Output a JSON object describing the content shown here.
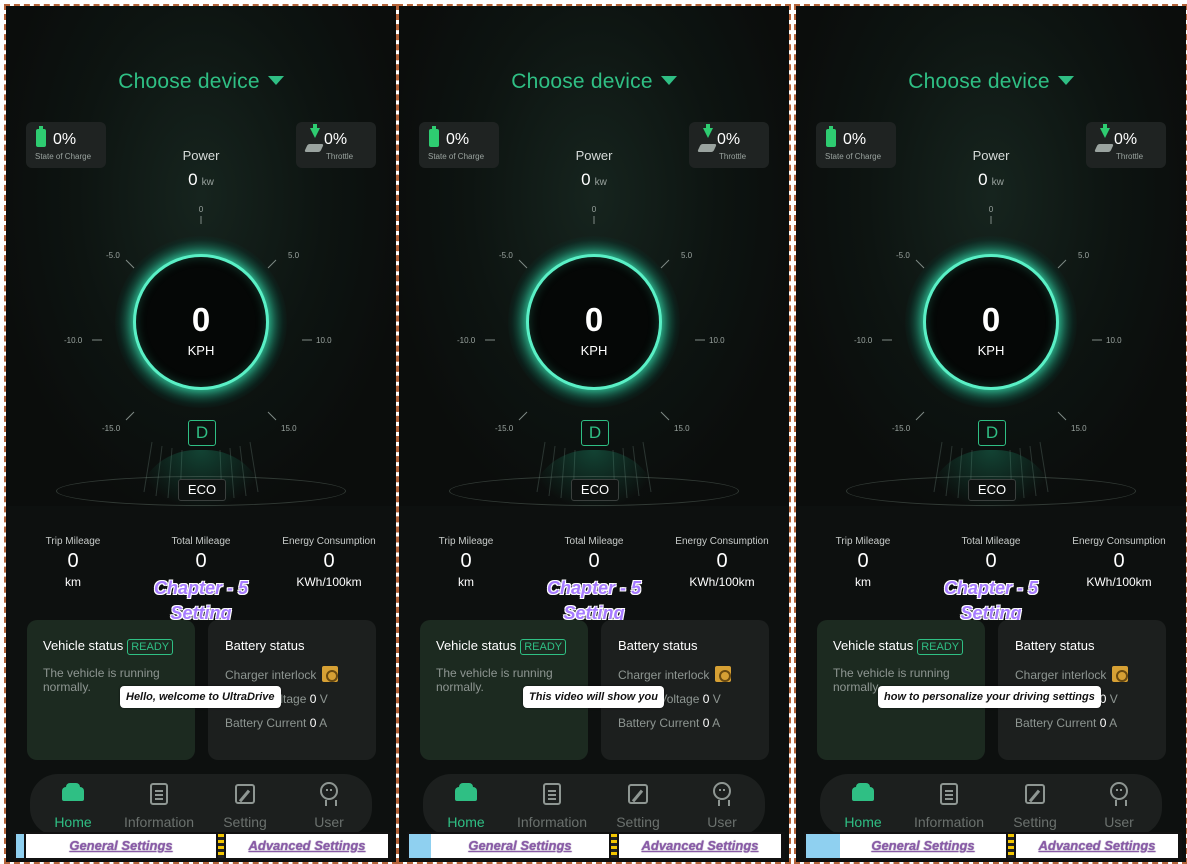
{
  "title": "Choose device",
  "state_of_charge": {
    "value": "0%",
    "label": "State of Charge"
  },
  "throttle": {
    "value": "0%",
    "label": "Throttle"
  },
  "power": {
    "label": "Power",
    "value": "0",
    "unit": "kw"
  },
  "gauge": {
    "ticks": [
      "0",
      "5.0",
      "10.0",
      "15.0",
      "-5.0",
      "-10.0",
      "-15.0"
    ],
    "speed": "0",
    "speed_unit": "KPH",
    "gear": "D",
    "mode": "ECO"
  },
  "stats": {
    "trip": {
      "label": "Trip Mileage",
      "value": "0",
      "unit": "km"
    },
    "total": {
      "label": "Total Mileage",
      "value": "0",
      "unit": ""
    },
    "energy": {
      "label": "Energy Consumption",
      "value": "0",
      "unit": "KWh/100km"
    }
  },
  "chapter": {
    "line1": "Chapter - 5",
    "line2": "Setting"
  },
  "vehicle": {
    "title": "Vehicle status",
    "badge": "READY",
    "desc": "The vehicle is running normally."
  },
  "battery": {
    "title": "Battery status",
    "charger_label": "Charger interlock",
    "voltage_label": "Battery Voltage",
    "voltage_value": "0",
    "voltage_unit": "V",
    "current_label": "Battery Current",
    "current_value": "0",
    "current_unit": "A"
  },
  "nav": [
    {
      "label": "Home",
      "icon": "car-icon",
      "active": true
    },
    {
      "label": "Information",
      "icon": "document-icon",
      "active": false
    },
    {
      "label": "Setting",
      "icon": "edit-icon",
      "active": false
    },
    {
      "label": "User",
      "icon": "user-icon",
      "active": false
    }
  ],
  "tabs": {
    "general": "General Settings",
    "advanced": "Advanced Settings"
  },
  "captions": [
    "Hello, welcome to UltraDrive",
    "This video will show you",
    "how to personalize your driving settings"
  ],
  "progress": [
    0.02,
    0.06,
    0.09
  ],
  "colors": {
    "accent": "#2fbf84",
    "background": "#0d100f",
    "card": "#1c1f1e",
    "chapter": "#a77cff"
  }
}
